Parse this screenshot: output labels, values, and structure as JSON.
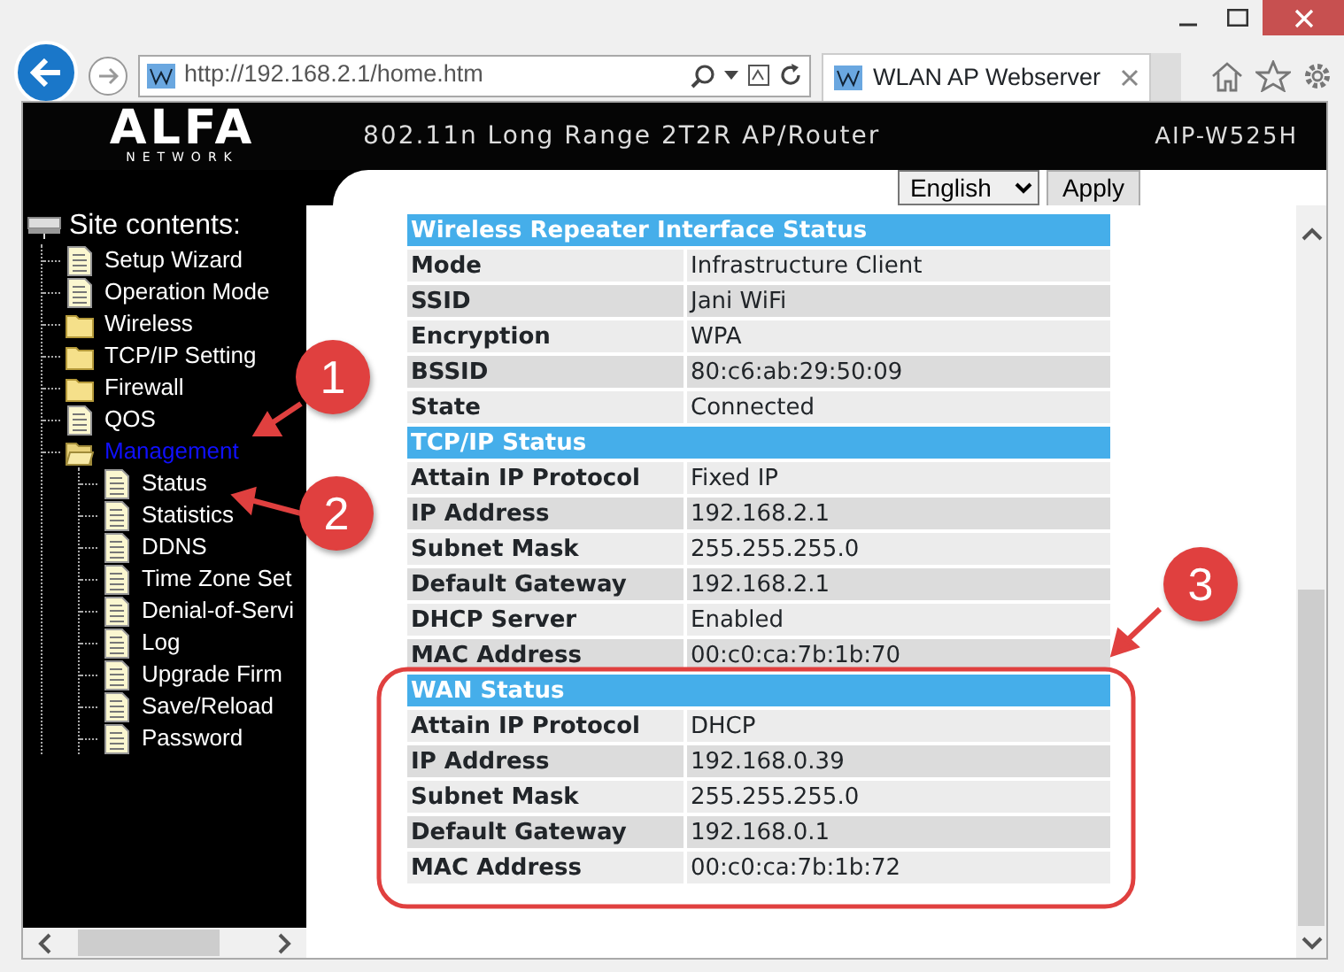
{
  "browser": {
    "url": "http://192.168.2.1/home.htm",
    "tab_title": "WLAN AP Webserver"
  },
  "banner": {
    "logo": "ALFA",
    "logo_sub": "NETWORK",
    "subtitle": "802.11n Long Range 2T2R AP/Router",
    "model": "AIP-W525H"
  },
  "language": {
    "value": "English",
    "button": "Apply"
  },
  "sidebar": {
    "title": "Site contents:",
    "items": [
      {
        "label": "Setup Wizard",
        "kind": "page",
        "selected": false
      },
      {
        "label": "Operation Mode",
        "kind": "page",
        "selected": false
      },
      {
        "label": "Wireless",
        "kind": "folder",
        "selected": false,
        "expanded": false
      },
      {
        "label": "TCP/IP Setting",
        "kind": "folder",
        "selected": false,
        "expanded": false
      },
      {
        "label": "Firewall",
        "kind": "folder",
        "selected": false,
        "expanded": false
      },
      {
        "label": "QOS",
        "kind": "page",
        "selected": false
      },
      {
        "label": "Management",
        "kind": "folder",
        "selected": true,
        "expanded": true,
        "children": [
          {
            "label": "Status",
            "kind": "page",
            "selected": false
          },
          {
            "label": "Statistics",
            "kind": "page",
            "selected": false
          },
          {
            "label": "DDNS",
            "kind": "page",
            "selected": false
          },
          {
            "label": "Time Zone Set",
            "kind": "page",
            "selected": false
          },
          {
            "label": "Denial-of-Servi",
            "kind": "page",
            "selected": false
          },
          {
            "label": "Log",
            "kind": "page",
            "selected": false
          },
          {
            "label": "Upgrade Firm",
            "kind": "page",
            "selected": false
          },
          {
            "label": "Save/Reload",
            "kind": "page",
            "selected": false
          },
          {
            "label": "Password",
            "kind": "page",
            "selected": false
          }
        ]
      }
    ]
  },
  "sections": [
    {
      "title": "Wireless Repeater Interface Status",
      "rows": [
        {
          "label": "Mode",
          "value": "Infrastructure Client"
        },
        {
          "label": "SSID",
          "value": "Jani WiFi"
        },
        {
          "label": "Encryption",
          "value": "WPA"
        },
        {
          "label": "BSSID",
          "value": "80:c6:ab:29:50:09"
        },
        {
          "label": "State",
          "value": "Connected"
        }
      ]
    },
    {
      "title": "TCP/IP Status",
      "rows": [
        {
          "label": "Attain IP Protocol",
          "value": "Fixed IP"
        },
        {
          "label": "IP Address",
          "value": "192.168.2.1"
        },
        {
          "label": "Subnet Mask",
          "value": "255.255.255.0"
        },
        {
          "label": "Default Gateway",
          "value": "192.168.2.1"
        },
        {
          "label": "DHCP Server",
          "value": "Enabled"
        },
        {
          "label": "MAC Address",
          "value": "00:c0:ca:7b:1b:70"
        }
      ]
    },
    {
      "title": "WAN Status",
      "rows": [
        {
          "label": "Attain IP Protocol",
          "value": "DHCP"
        },
        {
          "label": "IP Address",
          "value": "192.168.0.39"
        },
        {
          "label": "Subnet Mask",
          "value": "255.255.255.0"
        },
        {
          "label": "Default Gateway",
          "value": "192.168.0.1"
        },
        {
          "label": "MAC Address",
          "value": "00:c0:ca:7b:1b:72"
        }
      ]
    }
  ],
  "annotations": [
    {
      "label": "1"
    },
    {
      "label": "2"
    },
    {
      "label": "3"
    }
  ]
}
